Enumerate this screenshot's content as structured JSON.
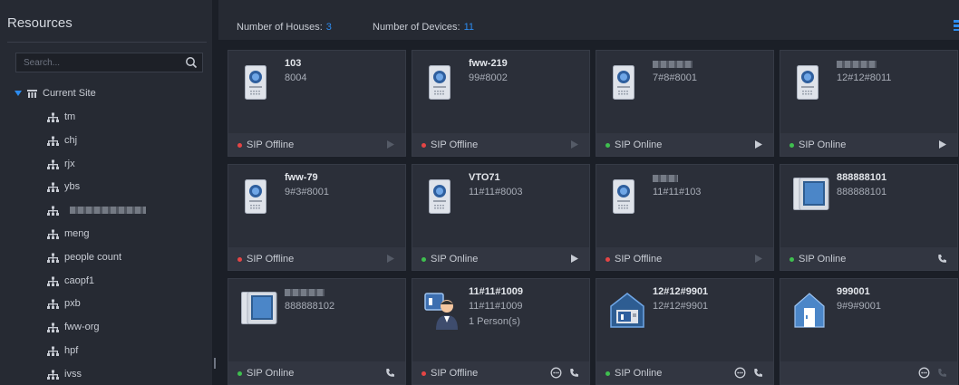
{
  "sidebar": {
    "title": "Resources",
    "search_placeholder": "Search...",
    "root_label": "Current Site",
    "items": [
      {
        "label": "tm"
      },
      {
        "label": "chj"
      },
      {
        "label": "rjx"
      },
      {
        "label": "ybs"
      },
      {
        "label": ""
      },
      {
        "label": "meng"
      },
      {
        "label": "people count"
      },
      {
        "label": "caopf1"
      },
      {
        "label": "pxb"
      },
      {
        "label": "fww-org"
      },
      {
        "label": "hpf"
      },
      {
        "label": "ivss"
      }
    ]
  },
  "header": {
    "houses_label": "Number of Houses:",
    "houses_count": "3",
    "devices_label": "Number of Devices:",
    "devices_count": "11"
  },
  "cards": [
    {
      "name": "103",
      "code": "8004",
      "extra": "",
      "status": "SIP Offline",
      "online": false,
      "icon": "door-station-icon",
      "actions": [
        "play-icon"
      ]
    },
    {
      "name": "fww-219",
      "code": "99#8002",
      "extra": "",
      "status": "SIP Offline",
      "online": false,
      "icon": "door-station-icon",
      "actions": [
        "play-icon"
      ]
    },
    {
      "name": "",
      "code": "7#8#8001",
      "extra": "",
      "status": "SIP Online",
      "online": true,
      "icon": "door-station-icon",
      "actions": [
        "play-icon"
      ]
    },
    {
      "name": "",
      "code": "12#12#8011",
      "extra": "",
      "status": "SIP Online",
      "online": true,
      "icon": "door-station-icon",
      "actions": [
        "play-icon"
      ]
    },
    {
      "name": "fww-79",
      "code": "9#3#8001",
      "extra": "",
      "status": "SIP Offline",
      "online": false,
      "icon": "door-station-icon",
      "actions": [
        "play-icon"
      ]
    },
    {
      "name": "VTO71",
      "code": "11#11#8003",
      "extra": "",
      "status": "SIP Online",
      "online": true,
      "icon": "door-station-icon",
      "actions": [
        "play-icon"
      ]
    },
    {
      "name": "",
      "code": "11#11#103",
      "extra": "",
      "status": "SIP Offline",
      "online": false,
      "icon": "door-station-icon",
      "actions": [
        "play-icon"
      ]
    },
    {
      "name": "888888101",
      "code": "888888101",
      "extra": "",
      "status": "SIP Online",
      "online": true,
      "icon": "indoor-monitor-icon",
      "actions": [
        "phone-icon"
      ]
    },
    {
      "name": "",
      "code": "888888102",
      "extra": "",
      "status": "SIP Online",
      "online": true,
      "icon": "indoor-monitor-icon",
      "actions": [
        "phone-icon"
      ]
    },
    {
      "name": "11#11#1009",
      "code": "11#11#1009",
      "extra": "1 Person(s)",
      "status": "SIP Offline",
      "online": false,
      "icon": "person-card-icon",
      "actions": [
        "message-icon",
        "phone-icon"
      ]
    },
    {
      "name": "12#12#9901",
      "code": "12#12#9901",
      "extra": "",
      "status": "SIP Online",
      "online": true,
      "icon": "house-monitor-icon",
      "actions": [
        "message-icon",
        "phone-icon"
      ]
    },
    {
      "name": "999001",
      "code": "9#9#9001",
      "extra": "",
      "status": "",
      "online": null,
      "icon": "house-door-icon",
      "actions": [
        "message-icon",
        "phone-icon"
      ]
    }
  ],
  "colors": {
    "accent": "#2d8cf0",
    "online": "#3fbf4f",
    "offline": "#e54545",
    "card_bg": "#2b2f39",
    "panel_bg": "#262a33"
  }
}
